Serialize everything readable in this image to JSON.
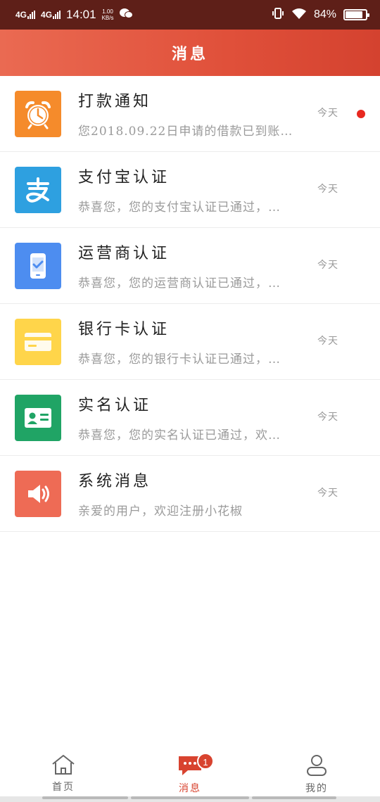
{
  "status_bar": {
    "net1": "4G",
    "net2": "4G",
    "time": "14:01",
    "speed_value": "1.00",
    "speed_unit": "KB/s",
    "battery": "84%",
    "battery_level": 0.84,
    "icons": [
      "signal-icon",
      "wechat-icon",
      "vibrate-icon",
      "wifi-icon",
      "battery-icon"
    ]
  },
  "header": {
    "title": "消息"
  },
  "messages": [
    {
      "icon": "alarm-clock-icon",
      "color": "#f58b2b",
      "title": "打款通知",
      "preview": "您2018.09.22日申请的借款已到账…",
      "date": "今天",
      "unread": true
    },
    {
      "icon": "alipay-icon",
      "color": "#2ea0e0",
      "title": "支付宝认证",
      "preview": "恭喜您，您的支付宝认证已通过，…",
      "date": "今天",
      "unread": false
    },
    {
      "icon": "phone-check-icon",
      "color": "#4d8df0",
      "title": "运营商认证",
      "preview": "恭喜您，您的运营商认证已通过，…",
      "date": "今天",
      "unread": false
    },
    {
      "icon": "bank-card-icon",
      "color": "#ffd54a",
      "title": "银行卡认证",
      "preview": "恭喜您，您的银行卡认证已通过，…",
      "date": "今天",
      "unread": false
    },
    {
      "icon": "id-card-icon",
      "color": "#20a465",
      "title": "实名认证",
      "preview": "恭喜您，您的实名认证已通过，欢…",
      "date": "今天",
      "unread": false
    },
    {
      "icon": "speaker-icon",
      "color": "#ee6b55",
      "title": "系统消息",
      "preview": "亲爱的用户，欢迎注册小花椒",
      "date": "今天",
      "unread": false
    }
  ],
  "bottom_nav": {
    "home": {
      "label": "首页",
      "icon": "home-icon"
    },
    "messages": {
      "label": "消息",
      "icon": "chat-bubble-icon",
      "badge": "1"
    },
    "me": {
      "label": "我的",
      "icon": "user-icon"
    }
  }
}
